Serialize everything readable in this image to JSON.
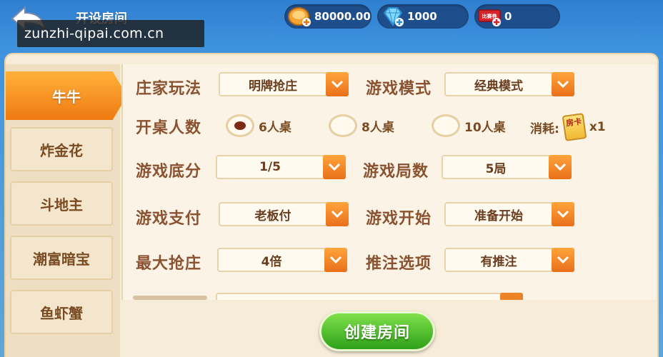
{
  "header": {
    "title": "开设房间",
    "watermark": "zunzhi-qipai.com.cn",
    "gold": "80000.00",
    "diamond": "1000",
    "ticket_badge": "比赛券",
    "ticket": "0"
  },
  "sidebar": {
    "tabs": [
      {
        "label": "牛牛",
        "active": true
      },
      {
        "label": "炸金花",
        "active": false
      },
      {
        "label": "斗地主",
        "active": false
      },
      {
        "label": "潮富暗宝",
        "active": false
      },
      {
        "label": "鱼虾蟹",
        "active": false
      }
    ]
  },
  "form": {
    "banker_mode": {
      "label": "庄家玩法",
      "value": "明牌抢庄"
    },
    "game_mode": {
      "label": "游戏模式",
      "value": "经典模式"
    },
    "table_size": {
      "label": "开桌人数",
      "options": [
        "6人桌",
        "8人桌",
        "10人桌"
      ],
      "selected": "6人桌"
    },
    "cost": {
      "label": "消耗:",
      "card_text": "房卡",
      "amount": "x1"
    },
    "base_score": {
      "label": "游戏底分",
      "value": "1/5"
    },
    "rounds": {
      "label": "游戏局数",
      "value": "5局"
    },
    "payment": {
      "label": "游戏支付",
      "value": "老板付"
    },
    "start": {
      "label": "游戏开始",
      "value": "准备开始"
    },
    "max_grab": {
      "label": "最大抢庄",
      "value": "4倍"
    },
    "push_bet": {
      "label": "推注选项",
      "value": "有推注"
    }
  },
  "create_button": "创建房间",
  "colors": {
    "accent_orange": "#f07a12",
    "button_green": "#2fa11a",
    "label_brown": "#8a5230",
    "panel_bg": "#f6ecd8"
  }
}
